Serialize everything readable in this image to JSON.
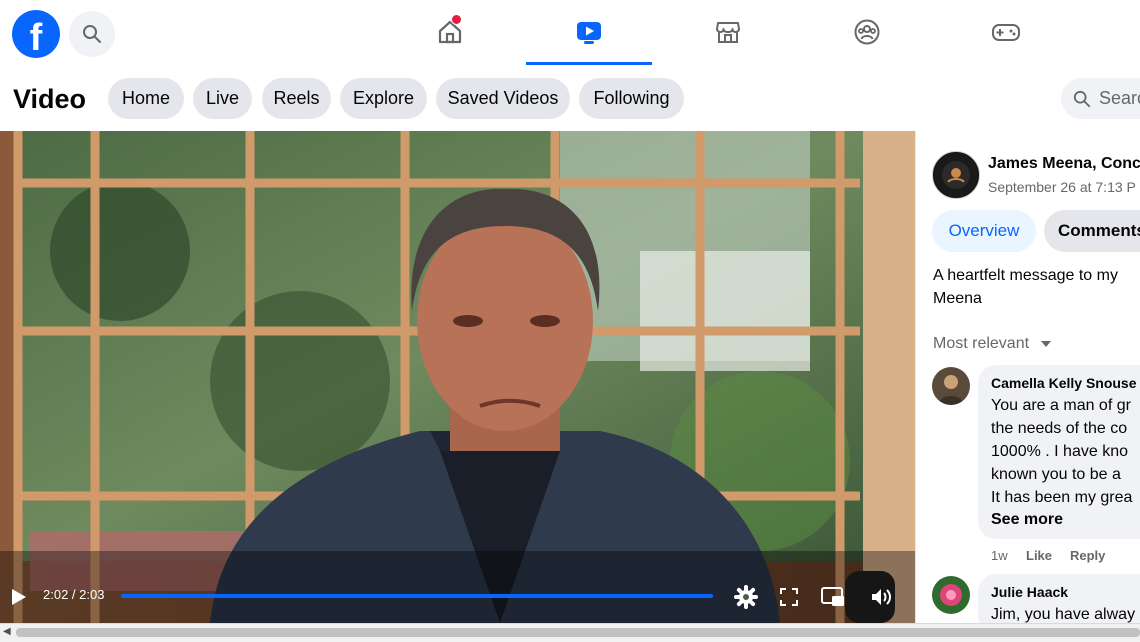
{
  "nav": {
    "logo_letter": "f",
    "tabs": [
      "home",
      "video",
      "marketplace",
      "groups",
      "gaming"
    ],
    "active_tab": "video",
    "home_notification": true
  },
  "video_header": {
    "title": "Video",
    "pills": [
      "Home",
      "Live",
      "Reels",
      "Explore",
      "Saved Videos",
      "Following"
    ],
    "search_placeholder": "Searc"
  },
  "player": {
    "time": "2:02 / 2:03",
    "progress_fraction": 0.99
  },
  "post": {
    "author": "James Meena, Conc",
    "date": "September 26 at 7:13 P",
    "tabs": {
      "overview": "Overview",
      "comments": "Comments"
    },
    "description_lines": [
      "A heartfelt message to my",
      "Meena"
    ],
    "sort_label": "Most relevant"
  },
  "comments": [
    {
      "name": "Camella Kelly Snouse",
      "lines": [
        "You are a man of gr",
        "the needs of the co",
        "1000% . I have kno",
        "known you to be a",
        "It has been my grea"
      ],
      "see_more": "See more",
      "time": "1w",
      "like": "Like",
      "reply": "Reply"
    },
    {
      "name": "Julie Haack",
      "lines": [
        "Jim, you have alway"
      ]
    }
  ],
  "colors": {
    "brand": "#0866ff",
    "pill_bg": "#e4e6eb",
    "overview_bg": "#ebf5ff",
    "notification": "#e41e3f"
  }
}
